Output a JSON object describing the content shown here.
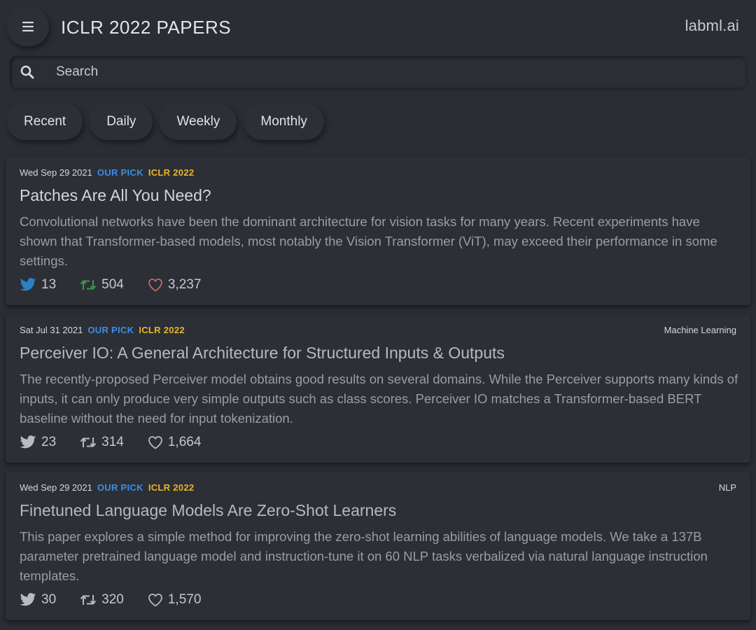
{
  "header": {
    "title": "ICLR 2022 PAPERS",
    "brand": "labml.ai",
    "menu_icon": "hamburger-menu-icon"
  },
  "search": {
    "placeholder": "Search",
    "value": "",
    "icon": "search-icon"
  },
  "tabs": [
    {
      "label": "Recent"
    },
    {
      "label": "Daily"
    },
    {
      "label": "Weekly"
    },
    {
      "label": "Monthly"
    }
  ],
  "colors": {
    "background": "#2a2d33",
    "our_pick": "#3d8ee6",
    "conference": "#e9b528",
    "tweets_active": "#2d81c3",
    "retweets_active": "#3a9a48",
    "likes_active": "#c26a6a",
    "icons_inactive": "#b8bbc0"
  },
  "papers": [
    {
      "date": "Wed Sep 29 2021",
      "pick": "OUR PICK",
      "conference": "ICLR 2022",
      "category": "",
      "title": "Patches Are All You Need?",
      "abstract": "Convolutional networks have been the dominant architecture for vision tasks for many years. Recent experiments have shown that Transformer-based models, most notably the Vision Transformer (ViT), may exceed their performance in some settings.",
      "tweets": "13",
      "retweets": "504",
      "likes": "3,237",
      "icons_colored": true
    },
    {
      "date": "Sat Jul 31 2021",
      "pick": "OUR PICK",
      "conference": "ICLR 2022",
      "category": "Machine Learning",
      "title": "Perceiver IO: A General Architecture for Structured Inputs & Outputs",
      "abstract": "The recently-proposed Perceiver model obtains good results on several domains. While the Perceiver supports many kinds of inputs, it can only produce very simple outputs such as class scores. Perceiver IO matches a Transformer-based BERT baseline without the need for input tokenization.",
      "tweets": "23",
      "retweets": "314",
      "likes": "1,664",
      "icons_colored": false
    },
    {
      "date": "Wed Sep 29 2021",
      "pick": "OUR PICK",
      "conference": "ICLR 2022",
      "category": "NLP",
      "title": "Finetuned Language Models Are Zero-Shot Learners",
      "abstract": "This paper explores a simple method for improving the zero-shot learning abilities of language models. We take a 137B parameter pretrained language model and instruction-tune it on 60 NLP tasks verbalized via natural language instruction templates.",
      "tweets": "30",
      "retweets": "320",
      "likes": "1,570",
      "icons_colored": false
    }
  ]
}
